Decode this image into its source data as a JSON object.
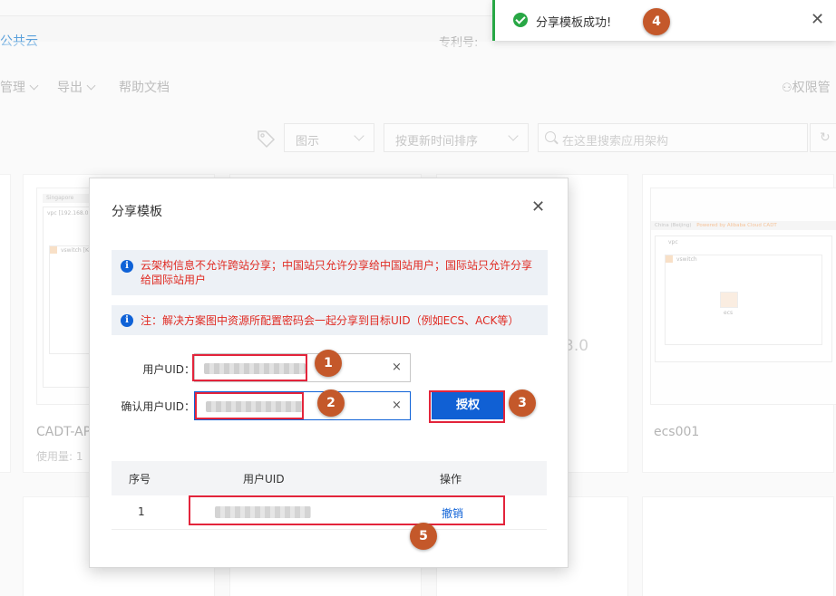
{
  "background": {
    "brand": "公共云",
    "patent_label": "专利号:",
    "menu": [
      {
        "label": "管理"
      },
      {
        "label": "导出"
      },
      {
        "label": "帮助文档"
      }
    ],
    "rights_label": "权限管",
    "filters": {
      "view_select": "图示",
      "sort_select": "按更新时间排序",
      "search_placeholder": "在这里搜索应用架构"
    },
    "cards": [
      {
        "name": "CADT-AP",
        "usage": "使用量: 1",
        "region": "Singapore",
        "vpc": "vpc [192.168.0.",
        "vswitch": "vswitch [K-"
      },
      {
        "name": "ecs001",
        "region": "China (Beijing)",
        "powered": "Powered by Alibaba Cloud CADT",
        "vpc": "vpc",
        "vswitch": "vswitch",
        "node": "ecs"
      }
    ],
    "partial_card_text": "3.0"
  },
  "toast": {
    "message": "分享模板成功!",
    "color": "#28a745"
  },
  "modal": {
    "title": "分享模板",
    "notice1": "云架构信息不允许跨站分享；中国站只允许分享给中国站用户；国际站只允许分享给国际站用户",
    "notice2": "注：解决方案图中资源所配置密码会一起分享到目标UID（例如ECS、ACK等）",
    "user_uid_label": "用户UID：",
    "confirm_uid_label": "确认用户UID：",
    "grant_button": "授权",
    "table": {
      "headers": [
        "序号",
        "用户UID",
        "操作"
      ],
      "rows": [
        {
          "index": "1",
          "action": "撤销"
        }
      ]
    }
  },
  "callouts": [
    "1",
    "2",
    "3",
    "4",
    "5"
  ],
  "colors": {
    "accent": "#0f62d7",
    "warning_text": "#e02a22",
    "highlight": "#e3243b",
    "callout": "#c4582a"
  }
}
